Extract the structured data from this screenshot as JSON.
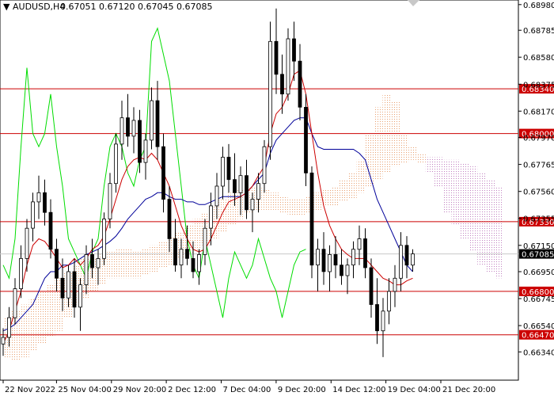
{
  "header": {
    "symbol": "AUDUSD,H4",
    "ohlc": "0.67051 0.67120 0.67045 0.67085",
    "arrow": "▼"
  },
  "chart_data": {
    "type": "candlestick",
    "title": "AUDUSD,H4",
    "ylim": [
      0.66125,
      0.69015
    ],
    "y_ticks": [
      "0.68980",
      "0.68785",
      "0.68580",
      "0.68375",
      "0.68170",
      "0.67970",
      "0.67765",
      "0.67560",
      "0.67355",
      "0.67150",
      "0.66950",
      "0.66745",
      "0.66540",
      "0.66340",
      "0.66135"
    ],
    "x_ticks": [
      "22 Nov 2022",
      "25 Nov 04:00",
      "29 Nov 20:00",
      "2 Dec 12:00",
      "7 Dec 04:00",
      "9 Dec 20:00",
      "14 Dec 12:00",
      "19 Dec 04:00",
      "21 Dec 20:00"
    ],
    "levels": [
      {
        "label": "0.68340",
        "value": 0.6834
      },
      {
        "label": "0.68000",
        "value": 0.68
      },
      {
        "label": "0.67330",
        "value": 0.6733
      },
      {
        "label": "0.66800",
        "value": 0.668
      },
      {
        "label": "0.66470",
        "value": 0.6647
      }
    ],
    "last_price": {
      "label": "0.67085",
      "value": 0.67085
    },
    "level_color": "#cc0000",
    "candle_color": "#000000",
    "tenkan_color": "#cc0000",
    "kijun_color": "#000099",
    "chikou_color": "#00dd00",
    "cloud_color": "#e8a070",
    "cloud_alt_color": "#c080c0",
    "candles": [
      [
        0.664,
        0.6652,
        0.6631,
        0.6645
      ],
      [
        0.6645,
        0.6668,
        0.6638,
        0.666
      ],
      [
        0.666,
        0.669,
        0.6655,
        0.6682
      ],
      [
        0.6682,
        0.6715,
        0.6675,
        0.6705
      ],
      [
        0.6705,
        0.6735,
        0.6695,
        0.6728
      ],
      [
        0.6728,
        0.6755,
        0.6718,
        0.6748
      ],
      [
        0.6748,
        0.6768,
        0.6735,
        0.6755
      ],
      [
        0.6755,
        0.6765,
        0.673,
        0.674
      ],
      [
        0.674,
        0.675,
        0.6705,
        0.6712
      ],
      [
        0.6712,
        0.672,
        0.668,
        0.669
      ],
      [
        0.669,
        0.6705,
        0.6665,
        0.6675
      ],
      [
        0.6675,
        0.67,
        0.6668,
        0.6695
      ],
      [
        0.6695,
        0.6705,
        0.666,
        0.6668
      ],
      [
        0.6668,
        0.669,
        0.665,
        0.6685
      ],
      [
        0.6685,
        0.6715,
        0.6678,
        0.6708
      ],
      [
        0.6708,
        0.672,
        0.669,
        0.6698
      ],
      [
        0.6698,
        0.6712,
        0.6685,
        0.6705
      ],
      [
        0.6705,
        0.674,
        0.67,
        0.6735
      ],
      [
        0.6735,
        0.677,
        0.6728,
        0.6762
      ],
      [
        0.6762,
        0.68,
        0.6755,
        0.6792
      ],
      [
        0.6792,
        0.6825,
        0.678,
        0.6812
      ],
      [
        0.6812,
        0.683,
        0.679,
        0.6798
      ],
      [
        0.6798,
        0.682,
        0.6785,
        0.681
      ],
      [
        0.681,
        0.6818,
        0.677,
        0.6778
      ],
      [
        0.6778,
        0.68,
        0.6765,
        0.6795
      ],
      [
        0.6795,
        0.6835,
        0.6788,
        0.6825
      ],
      [
        0.6825,
        0.684,
        0.678,
        0.679
      ],
      [
        0.679,
        0.68,
        0.674,
        0.675
      ],
      [
        0.675,
        0.676,
        0.671,
        0.672
      ],
      [
        0.672,
        0.6735,
        0.6695,
        0.67
      ],
      [
        0.67,
        0.672,
        0.669,
        0.6712
      ],
      [
        0.6712,
        0.673,
        0.67,
        0.6705
      ],
      [
        0.6705,
        0.6718,
        0.669,
        0.6695
      ],
      [
        0.6695,
        0.6712,
        0.6685,
        0.6708
      ],
      [
        0.6708,
        0.6735,
        0.67,
        0.6728
      ],
      [
        0.6728,
        0.6755,
        0.6715,
        0.6745
      ],
      [
        0.6745,
        0.677,
        0.6735,
        0.676
      ],
      [
        0.676,
        0.679,
        0.675,
        0.6782
      ],
      [
        0.6782,
        0.6792,
        0.6755,
        0.6765
      ],
      [
        0.6765,
        0.6785,
        0.6745,
        0.6755
      ],
      [
        0.6755,
        0.6775,
        0.6738,
        0.6768
      ],
      [
        0.6768,
        0.678,
        0.6735,
        0.6742
      ],
      [
        0.6742,
        0.6755,
        0.6725,
        0.675
      ],
      [
        0.675,
        0.677,
        0.674,
        0.6762
      ],
      [
        0.6762,
        0.6795,
        0.6755,
        0.679
      ],
      [
        0.679,
        0.6885,
        0.678,
        0.687
      ],
      [
        0.687,
        0.6895,
        0.683,
        0.6845
      ],
      [
        0.6845,
        0.686,
        0.6815,
        0.683
      ],
      [
        0.683,
        0.688,
        0.6825,
        0.6872
      ],
      [
        0.6872,
        0.6885,
        0.684,
        0.6855
      ],
      [
        0.6855,
        0.6868,
        0.681,
        0.682
      ],
      [
        0.682,
        0.683,
        0.676,
        0.677
      ],
      [
        0.677,
        0.6775,
        0.669,
        0.67
      ],
      [
        0.67,
        0.672,
        0.668,
        0.6712
      ],
      [
        0.6712,
        0.6725,
        0.6685,
        0.6695
      ],
      [
        0.6695,
        0.6715,
        0.668,
        0.6708
      ],
      [
        0.6708,
        0.6722,
        0.669,
        0.67
      ],
      [
        0.67,
        0.6712,
        0.6685,
        0.6692
      ],
      [
        0.6692,
        0.6705,
        0.6678,
        0.67
      ],
      [
        0.67,
        0.6718,
        0.669,
        0.6712
      ],
      [
        0.6712,
        0.673,
        0.67,
        0.672
      ],
      [
        0.672,
        0.6728,
        0.669,
        0.6698
      ],
      [
        0.6698,
        0.6705,
        0.666,
        0.667
      ],
      [
        0.667,
        0.669,
        0.664,
        0.665
      ],
      [
        0.665,
        0.6675,
        0.663,
        0.6665
      ],
      [
        0.6665,
        0.669,
        0.6655,
        0.668
      ],
      [
        0.668,
        0.67,
        0.6668,
        0.669
      ],
      [
        0.669,
        0.6725,
        0.668,
        0.6715
      ],
      [
        0.6715,
        0.6722,
        0.669,
        0.67
      ],
      [
        0.67,
        0.6712,
        0.6695,
        0.67085
      ]
    ],
    "tenkan": [
      0.664,
      0.665,
      0.6665,
      0.668,
      0.67,
      0.6715,
      0.672,
      0.6718,
      0.6712,
      0.6705,
      0.6698,
      0.67,
      0.6705,
      0.67,
      0.6705,
      0.6712,
      0.6715,
      0.6722,
      0.6735,
      0.675,
      0.6765,
      0.6775,
      0.678,
      0.6782,
      0.678,
      0.6785,
      0.678,
      0.677,
      0.676,
      0.6745,
      0.673,
      0.672,
      0.6712,
      0.671,
      0.6712,
      0.672,
      0.673,
      0.674,
      0.6748,
      0.675,
      0.6752,
      0.6755,
      0.676,
      0.6768,
      0.6775,
      0.68,
      0.6815,
      0.682,
      0.683,
      0.6845,
      0.6848,
      0.683,
      0.68,
      0.677,
      0.6745,
      0.673,
      0.672,
      0.6712,
      0.6708,
      0.6705,
      0.6705,
      0.6705,
      0.67,
      0.6695,
      0.669,
      0.6688,
      0.6685,
      0.6685,
      0.6688,
      0.669
    ],
    "kijun": [
      0.665,
      0.6652,
      0.6655,
      0.666,
      0.6665,
      0.667,
      0.668,
      0.669,
      0.6695,
      0.6695,
      0.67,
      0.67,
      0.6702,
      0.6705,
      0.6708,
      0.671,
      0.6712,
      0.6715,
      0.6718,
      0.6722,
      0.6728,
      0.6735,
      0.674,
      0.6745,
      0.675,
      0.6752,
      0.6755,
      0.6755,
      0.6752,
      0.675,
      0.675,
      0.6748,
      0.6748,
      0.6746,
      0.6746,
      0.6748,
      0.675,
      0.6752,
      0.6752,
      0.6752,
      0.6752,
      0.6755,
      0.676,
      0.6765,
      0.677,
      0.6785,
      0.6795,
      0.68,
      0.6805,
      0.681,
      0.6812,
      0.6812,
      0.68,
      0.679,
      0.6788,
      0.6788,
      0.6788,
      0.6788,
      0.6788,
      0.6788,
      0.6785,
      0.678,
      0.6765,
      0.675,
      0.674,
      0.673,
      0.672,
      0.671,
      0.67,
      0.6695
    ],
    "chikou": [
      0.67,
      0.669,
      0.672,
      0.679,
      0.685,
      0.68,
      0.679,
      0.68,
      0.683,
      0.679,
      0.676,
      0.672,
      0.671,
      0.67,
      0.669,
      0.671,
      0.672,
      0.676,
      0.679,
      0.68,
      0.679,
      0.677,
      0.676,
      0.678,
      0.679,
      0.687,
      0.688,
      0.686,
      0.684,
      0.68,
      0.676,
      0.672,
      0.67,
      0.669,
      0.672,
      0.67,
      0.668,
      0.666,
      0.669,
      0.671,
      0.67,
      0.669,
      0.67,
      0.672,
      0.6705,
      0.669,
      0.668,
      0.666,
      0.668,
      0.67,
      0.671,
      0.6712
    ],
    "cloud": [
      [
        0.663,
        0.666
      ],
      [
        0.6628,
        0.6665
      ],
      [
        0.663,
        0.667
      ],
      [
        0.6635,
        0.6675
      ],
      [
        0.664,
        0.668
      ],
      [
        0.6645,
        0.6685
      ],
      [
        0.665,
        0.669
      ],
      [
        0.666,
        0.6695
      ],
      [
        0.667,
        0.67
      ],
      [
        0.6675,
        0.6705
      ],
      [
        0.668,
        0.6705
      ],
      [
        0.6685,
        0.6708
      ],
      [
        0.669,
        0.671
      ],
      [
        0.669,
        0.6712
      ],
      [
        0.669,
        0.6712
      ],
      [
        0.669,
        0.671
      ],
      [
        0.6692,
        0.6712
      ],
      [
        0.6695,
        0.6715
      ],
      [
        0.6698,
        0.6718
      ],
      [
        0.67,
        0.6722
      ],
      [
        0.6705,
        0.6725
      ],
      [
        0.6708,
        0.673
      ],
      [
        0.671,
        0.6735
      ],
      [
        0.6715,
        0.674
      ],
      [
        0.672,
        0.6745
      ],
      [
        0.6725,
        0.675
      ],
      [
        0.673,
        0.6755
      ],
      [
        0.6735,
        0.6758
      ],
      [
        0.674,
        0.676
      ],
      [
        0.6742,
        0.676
      ],
      [
        0.6742,
        0.6758
      ],
      [
        0.6742,
        0.6755
      ],
      [
        0.674,
        0.6752
      ],
      [
        0.6738,
        0.675
      ],
      [
        0.6738,
        0.675
      ],
      [
        0.674,
        0.6752
      ],
      [
        0.6742,
        0.6755
      ],
      [
        0.6745,
        0.6758
      ],
      [
        0.6745,
        0.676
      ],
      [
        0.6748,
        0.6765
      ],
      [
        0.675,
        0.677
      ],
      [
        0.6755,
        0.678
      ],
      [
        0.676,
        0.68
      ],
      [
        0.6765,
        0.682
      ],
      [
        0.677,
        0.683
      ],
      [
        0.6775,
        0.6825
      ],
      [
        0.6778,
        0.68
      ],
      [
        0.678,
        0.679
      ],
      [
        0.6778,
        0.6785
      ],
      [
        0.677,
        0.6782
      ],
      [
        0.676,
        0.6782
      ],
      [
        0.674,
        0.678
      ],
      [
        0.673,
        0.678
      ],
      [
        0.672,
        0.6778
      ],
      [
        0.671,
        0.6775
      ],
      [
        0.67,
        0.677
      ],
      [
        0.6695,
        0.6765
      ],
      [
        0.669,
        0.676
      ]
    ]
  }
}
